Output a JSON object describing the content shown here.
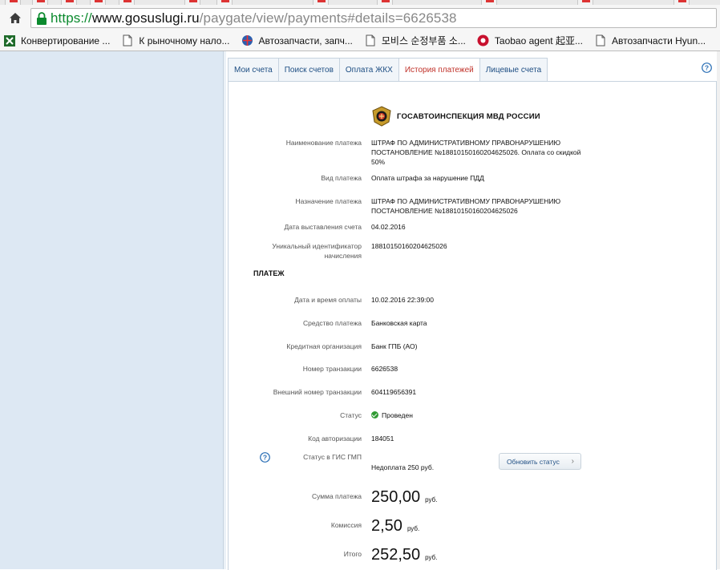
{
  "browser": {
    "url": {
      "scheme": "https://",
      "host": "www.gosuslugi.ru",
      "path": "/paygate/view/payments#details=6626538"
    },
    "bookmarks": [
      {
        "label": "Конвертирование ...",
        "icon": "excel-icon"
      },
      {
        "label": "К рыночному нало...",
        "icon": "page-icon"
      },
      {
        "label": "Автозапчасти, запч...",
        "icon": "globe-icon"
      },
      {
        "label": "모비스 순정부품 소...",
        "icon": "page-icon"
      },
      {
        "label": "Taobao agent 起亚...",
        "icon": "taobao-icon"
      },
      {
        "label": "Автозапчасти Hyun...",
        "icon": "page-icon"
      }
    ]
  },
  "tabs": [
    {
      "label": "Мои счета",
      "active": false
    },
    {
      "label": "Поиск счетов",
      "active": false
    },
    {
      "label": "Оплата ЖКХ",
      "active": false
    },
    {
      "label": "История платежей",
      "active": true
    },
    {
      "label": "Лицевые счета",
      "active": false
    }
  ],
  "org": {
    "name": "ГОСАВТОИНСПЕКЦИЯ МВД РОССИИ"
  },
  "bill": {
    "payment_name_label": "Наименование платежа",
    "payment_name": "ШТРАФ ПО АДМИНИСТРАТИВНОМУ ПРАВОНАРУШЕНИЮ ПОСТАНОВЛЕНИЕ №18810150160204625026. Оплата со скидкой 50%",
    "payment_type_label": "Вид платежа",
    "payment_type": "Оплата штрафа за нарушение ПДД",
    "purpose_label": "Назначение платежа",
    "purpose": "ШТРАФ ПО АДМИНИСТРАТИВНОМУ ПРАВОНАРУШЕНИЮ ПОСТАНОВЛЕНИЕ №18810150160204625026",
    "issue_date_label": "Дата выставления счета",
    "issue_date": "04.02.2016",
    "uid_label": "Уникальный идентификатор начисления",
    "uid": "18810150160204625026"
  },
  "payment": {
    "section_title": "ПЛАТЕЖ",
    "datetime_label": "Дата и время оплаты",
    "datetime": "10.02.2016 22:39:00",
    "method_label": "Средство платежа",
    "method": "Банковская карта",
    "bank_label": "Кредитная организация",
    "bank": "Банк ГПБ (АО)",
    "transaction_label": "Номер транзакции",
    "transaction": "6626538",
    "ext_transaction_label": "Внешний номер транзакции",
    "ext_transaction": "604119656391",
    "status_label": "Статус",
    "status": "Проведен",
    "auth_code_label": "Код авторизации",
    "auth_code": "184051",
    "gis_status_label": "Статус в ГИС ГМП",
    "gis_status": "Недоплата 250 руб.",
    "refresh_button": "Обновить статус",
    "sum_label": "Сумма платежа",
    "sum": "250,00",
    "commission_label": "Комиссия",
    "commission": "2,50",
    "total_label": "Итого",
    "total": "252,50",
    "currency": "руб."
  },
  "colors": {
    "accent_link": "#1e4e83",
    "active_tab": "#c0322a",
    "status_ok": "#2f9a33",
    "sidebar_bg": "#dde8f3"
  }
}
